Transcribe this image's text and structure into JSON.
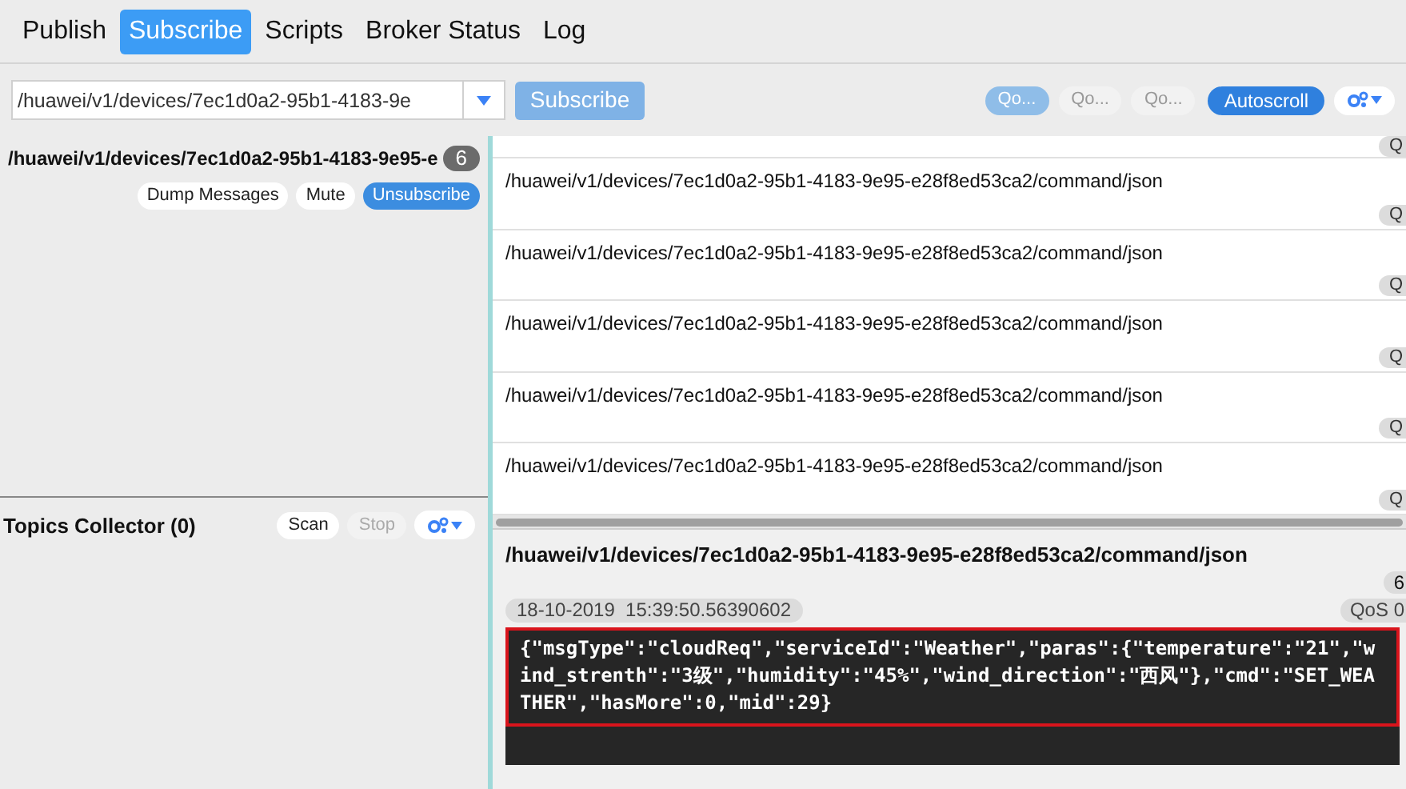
{
  "tabs": [
    {
      "label": "Publish",
      "selected": false
    },
    {
      "label": "Subscribe",
      "selected": true
    },
    {
      "label": "Scripts",
      "selected": false
    },
    {
      "label": "Broker Status",
      "selected": false
    },
    {
      "label": "Log",
      "selected": false
    }
  ],
  "toolbar": {
    "topic_input": {
      "value": "/huawei/v1/devices/7ec1d0a2-95b1-4183-9e"
    },
    "subscribe_button": {
      "label": "Subscribe",
      "disabled": true
    },
    "qos_buttons": [
      {
        "label": "Qo...",
        "selected": true
      },
      {
        "label": "Qo...",
        "selected": false
      },
      {
        "label": "Qo...",
        "selected": false
      }
    ],
    "autoscroll": {
      "label": "Autoscroll",
      "on": true
    }
  },
  "subscriptions": [
    {
      "topic": "/huawei/v1/devices/7ec1d0a2-95b1-4183-9e95-e",
      "count": "6",
      "buttons": [
        {
          "label": "Dump Messages",
          "kind": "plain"
        },
        {
          "label": "Mute",
          "kind": "plain"
        },
        {
          "label": "Unsubscribe",
          "kind": "primary"
        }
      ]
    }
  ],
  "topics_collector": {
    "title": "Topics Collector (0)",
    "buttons": [
      {
        "label": "Scan",
        "disabled": false
      },
      {
        "label": "Stop",
        "disabled": true
      }
    ]
  },
  "messages": [
    {
      "badge": "Q"
    },
    {
      "topic": "/huawei/v1/devices/7ec1d0a2-95b1-4183-9e95-e28f8ed53ca2/command/json",
      "badge": "Q"
    },
    {
      "topic": "/huawei/v1/devices/7ec1d0a2-95b1-4183-9e95-e28f8ed53ca2/command/json",
      "badge": "Q"
    },
    {
      "topic": "/huawei/v1/devices/7ec1d0a2-95b1-4183-9e95-e28f8ed53ca2/command/json",
      "badge": "Q"
    },
    {
      "topic": "/huawei/v1/devices/7ec1d0a2-95b1-4183-9e95-e28f8ed53ca2/command/json",
      "badge": "Q"
    },
    {
      "topic": "/huawei/v1/devices/7ec1d0a2-95b1-4183-9e95-e28f8ed53ca2/command/json",
      "badge": "Q"
    }
  ],
  "detail": {
    "topic": "/huawei/v1/devices/7ec1d0a2-95b1-4183-9e95-e28f8ed53ca2/command/json",
    "count": "6",
    "timestamp": "18-10-2019  15:39:50.56390602",
    "qos": "QoS 0",
    "payload": "{\"msgType\":\"cloudReq\",\"serviceId\":\"Weather\",\"paras\":{\"temperature\":\"21\",\"wind_strenth\":\"3级\",\"humidity\":\"45%\",\"wind_direction\":\"西风\"},\"cmd\":\"SET_WEATHER\",\"hasMore\":0,\"mid\":29}"
  }
}
